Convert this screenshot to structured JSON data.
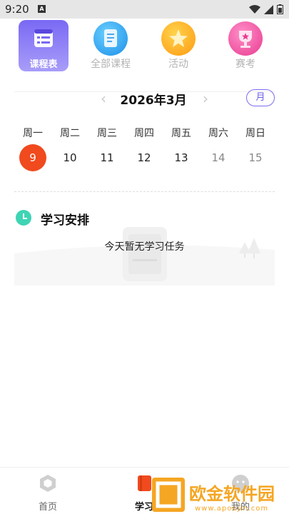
{
  "status_bar": {
    "time": "9:20",
    "notification_badge": "A"
  },
  "tabs": [
    {
      "label": "课程表",
      "icon": "schedule-icon",
      "active": true
    },
    {
      "label": "全部课程",
      "icon": "document-icon",
      "active": false
    },
    {
      "label": "活动",
      "icon": "star-icon",
      "active": false
    },
    {
      "label": "赛考",
      "icon": "trophy-icon",
      "active": false
    }
  ],
  "calendar": {
    "month_title": "2026年3月",
    "view_toggle": "月",
    "weekdays": [
      "周一",
      "周二",
      "周三",
      "周四",
      "周五",
      "周六",
      "周日"
    ],
    "dates": [
      "9",
      "10",
      "11",
      "12",
      "13",
      "14",
      "15"
    ],
    "today": "9"
  },
  "plan": {
    "title": "学习安排",
    "empty_text": "今天暂无学习任务"
  },
  "bottom_nav": [
    {
      "label": "首页",
      "icon": "hexagon-home-icon"
    },
    {
      "label": "学习",
      "icon": "book-icon"
    },
    {
      "label": "我的",
      "icon": "profile-icon"
    }
  ],
  "watermark": {
    "brand": "欧金软件园",
    "url": "www.apoujin.com"
  },
  "colors": {
    "accent": "#7a69f4",
    "today": "#f04a1e",
    "plan_icon": "#3fd4b4"
  }
}
